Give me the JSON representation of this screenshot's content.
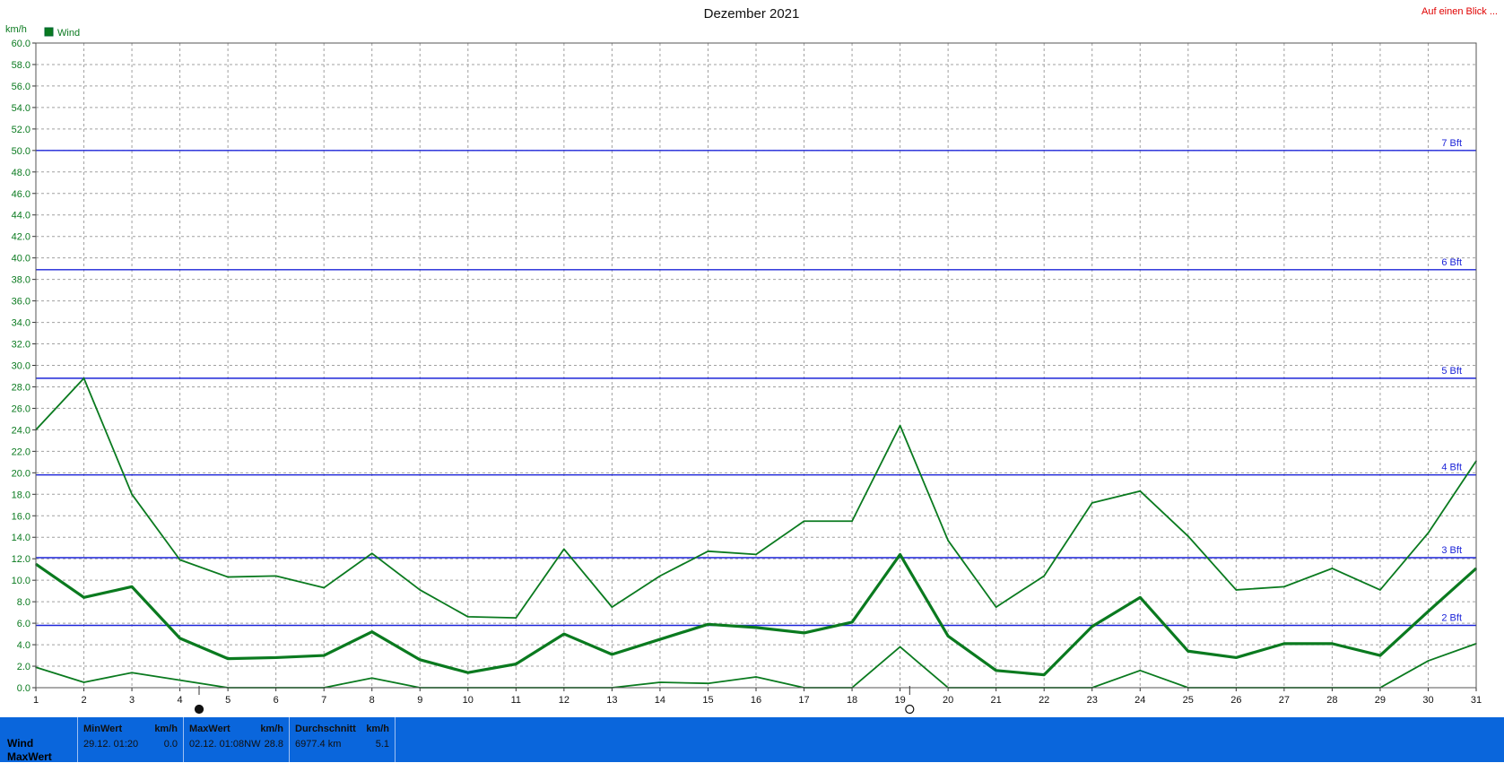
{
  "header": {
    "title": "Dezember 2021",
    "link_text": "Auf einen Blick ...",
    "unit": "km/h",
    "legend_label": "Wind"
  },
  "colors": {
    "series": "#0a7a1f",
    "legend_box": "#0a7a1f",
    "beaufort_line": "#1c24d8",
    "grid": "#a0a0a0",
    "link": "#e00000",
    "panel": "#0a66dc"
  },
  "chart_data": {
    "type": "line",
    "title": "Dezember 2021",
    "ylabel": "km/h",
    "xlabel": "",
    "ylim": [
      0,
      60
    ],
    "xlim": [
      1,
      31
    ],
    "grid": true,
    "legend": "top-left",
    "x": [
      1,
      2,
      3,
      4,
      5,
      6,
      7,
      8,
      9,
      10,
      11,
      12,
      13,
      14,
      15,
      16,
      17,
      18,
      19,
      20,
      21,
      22,
      23,
      24,
      25,
      26,
      27,
      28,
      29,
      30,
      31
    ],
    "y_ticks": [
      "0.0",
      "2.0",
      "4.0",
      "6.0",
      "8.0",
      "10.0",
      "12.0",
      "14.0",
      "16.0",
      "18.0",
      "20.0",
      "22.0",
      "24.0",
      "26.0",
      "28.0",
      "30.0",
      "32.0",
      "34.0",
      "36.0",
      "38.0",
      "40.0",
      "42.0",
      "44.0",
      "46.0",
      "48.0",
      "50.0",
      "52.0",
      "54.0",
      "56.0",
      "58.0",
      "60.0"
    ],
    "x_ticks": [
      "1",
      "2",
      "3",
      "4",
      "5",
      "6",
      "7",
      "8",
      "9",
      "10",
      "11",
      "12",
      "13",
      "14",
      "15",
      "16",
      "17",
      "18",
      "19",
      "20",
      "21",
      "22",
      "23",
      "24",
      "25",
      "26",
      "27",
      "28",
      "29",
      "30",
      "31"
    ],
    "series": [
      {
        "name": "",
        "stroke": "normal",
        "values": [
          24.0,
          28.8,
          18.0,
          11.9,
          10.3,
          10.4,
          9.3,
          12.5,
          9.1,
          6.6,
          6.5,
          12.9,
          7.5,
          10.4,
          12.7,
          12.4,
          15.5,
          15.5,
          24.4,
          13.7,
          7.5,
          10.4,
          17.2,
          18.3,
          14.1,
          9.1,
          9.4,
          11.1,
          9.1,
          14.4,
          21.1
        ]
      },
      {
        "name": "Wind",
        "stroke": "bold",
        "values": [
          11.5,
          8.4,
          9.4,
          4.6,
          2.7,
          2.8,
          3.0,
          5.2,
          2.6,
          1.4,
          2.2,
          5.0,
          3.1,
          4.5,
          5.9,
          5.6,
          5.1,
          6.1,
          12.4,
          4.8,
          1.6,
          1.2,
          5.7,
          8.4,
          3.4,
          2.8,
          4.1,
          4.1,
          3.0,
          7.1,
          11.1
        ]
      },
      {
        "name": "",
        "stroke": "normal",
        "values": [
          1.9,
          0.5,
          1.4,
          0.7,
          0.0,
          0.0,
          0.0,
          0.9,
          0.0,
          0.0,
          0.0,
          0.0,
          0.0,
          0.5,
          0.4,
          1.0,
          0.0,
          0.0,
          3.8,
          0.0,
          0.0,
          0.0,
          0.0,
          1.6,
          0.0,
          0.0,
          0.0,
          0.0,
          0.0,
          2.5,
          4.1
        ]
      }
    ],
    "beaufort": [
      {
        "label": "2 Bft",
        "value": 5.8
      },
      {
        "label": "3 Bft",
        "value": 12.1
      },
      {
        "label": "4 Bft",
        "value": 19.8
      },
      {
        "label": "5 Bft",
        "value": 28.8
      },
      {
        "label": "6 Bft",
        "value": 38.9
      },
      {
        "label": "7 Bft",
        "value": 50.0
      }
    ],
    "moon_phases": [
      {
        "day": 4.4,
        "symbol": "new-moon"
      },
      {
        "day": 19.2,
        "symbol": "full-moon"
      }
    ]
  },
  "stats": {
    "row_labels": [
      "Wind",
      "MaxWert"
    ],
    "min": {
      "header": "MinWert",
      "unit": "km/h",
      "time": "29.12.  01:20",
      "value": "0.0"
    },
    "max": {
      "header": "MaxWert",
      "unit": "km/h",
      "time": "02.12.  01:08NW",
      "value": "28.8"
    },
    "avg": {
      "header": "Durchschnitt",
      "unit": "km/h",
      "time": "6977.4 km",
      "value": "5.1"
    }
  }
}
